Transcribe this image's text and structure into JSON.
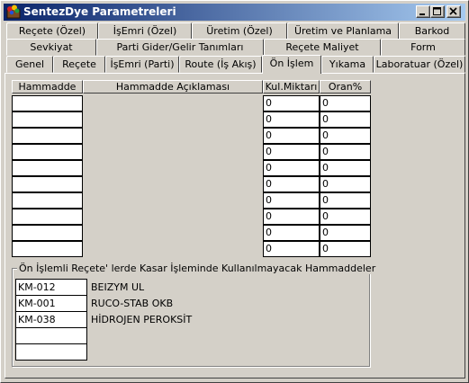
{
  "window": {
    "title": "SentezDye Parametreleri",
    "controls": {
      "minimize": "minimize-icon",
      "maximize": "maximize-icon",
      "close": "close-icon"
    }
  },
  "tabs": {
    "row1": [
      "Reçete (Özel)",
      "İşEmri (Özel)",
      "Üretim (Özel)",
      "Üretim ve Planlama",
      "Barkod"
    ],
    "row2": [
      "Sevkiyat",
      "Parti Gider/Gelir Tanımları",
      "Reçete Maliyet",
      "Form"
    ],
    "row3": [
      "Genel",
      "Reçete",
      "İşEmri (Parti)",
      "Route (İş Akış)",
      "Ön İşlem",
      "Yıkama",
      "Laboratuar (Özel)"
    ],
    "active": "Ön İşlem"
  },
  "grid": {
    "headers": [
      "Hammadde",
      "Hammadde Açıklaması",
      "Kul.Miktarı",
      "Oran%"
    ],
    "rows": [
      {
        "hammadde": "",
        "aciklama": "",
        "miktar": "0",
        "oran": "0"
      },
      {
        "hammadde": "",
        "aciklama": "",
        "miktar": "0",
        "oran": "0"
      },
      {
        "hammadde": "",
        "aciklama": "",
        "miktar": "0",
        "oran": "0"
      },
      {
        "hammadde": "",
        "aciklama": "",
        "miktar": "0",
        "oran": "0"
      },
      {
        "hammadde": "",
        "aciklama": "",
        "miktar": "0",
        "oran": "0"
      },
      {
        "hammadde": "",
        "aciklama": "",
        "miktar": "0",
        "oran": "0"
      },
      {
        "hammadde": "",
        "aciklama": "",
        "miktar": "0",
        "oran": "0"
      },
      {
        "hammadde": "",
        "aciklama": "",
        "miktar": "0",
        "oran": "0"
      },
      {
        "hammadde": "",
        "aciklama": "",
        "miktar": "0",
        "oran": "0"
      },
      {
        "hammadde": "",
        "aciklama": "",
        "miktar": "0",
        "oran": "0"
      }
    ]
  },
  "excluded_group": {
    "legend": "Ön İşlemli Reçete' lerde Kasar İşleminde Kullanılmayacak Hammaddeler",
    "items": [
      {
        "code": "KM-012",
        "desc": "BEIZYM UL"
      },
      {
        "code": "KM-001",
        "desc": "RUCO-STAB OKB"
      },
      {
        "code": "KM-038",
        "desc": "HİDROJEN PEROKSİT"
      },
      {
        "code": "",
        "desc": ""
      },
      {
        "code": "",
        "desc": ""
      }
    ]
  }
}
